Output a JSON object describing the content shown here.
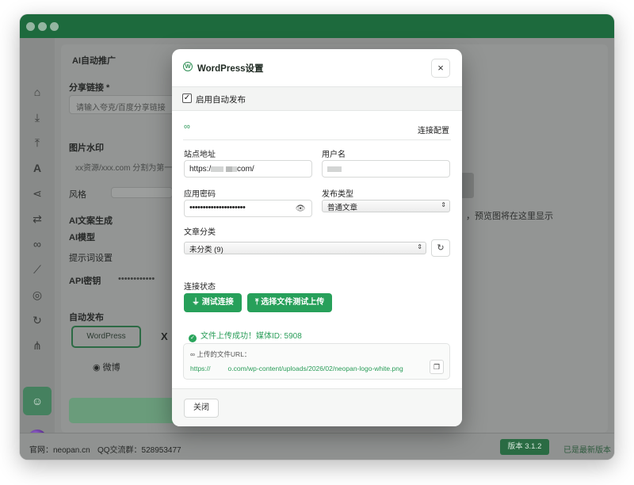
{
  "background": {
    "panel_title": "AI自动推广",
    "share_link_label": "分享链接 *",
    "share_link_placeholder": "请输入夸克/百度分享链接",
    "watermark_label": "图片水印",
    "watermark_placeholder": "xx资源/xxx.com  分割为第一",
    "style_label": "风格",
    "ai_copy_label": "AI文案生成",
    "ai_model_label": "AI模型",
    "prompt_label": "提示词设置",
    "api_key_label": "API密钥",
    "api_key_value": "••••••••••••",
    "auto_publish_label": "自动发布",
    "wordpress_btn": "WordPress",
    "x_btn": "X",
    "weibo_btn": "微博",
    "preview_hint": "，预览图将在这里显示",
    "footer_site": "官网：neopan.cn",
    "footer_qq": "QQ交流群：528953477",
    "version_badge": "版本 3.1.2",
    "latest_version": "已是最新版本"
  },
  "modal": {
    "title": "WordPress设置",
    "close_symbol": "×",
    "enable_auto_publish": "启用自动发布",
    "connection_config": "连接配置",
    "site_url_label": "站点地址",
    "site_url_prefix": "https:/",
    "site_url_suffix": "com/",
    "username_label": "用户名",
    "app_password_label": "应用密码",
    "app_password_value": "•••••••••••••••••••••",
    "post_type_label": "发布类型",
    "post_type_value": "普通文章",
    "category_label": "文章分类",
    "category_value": "未分类 (9)",
    "connection_status_label": "连接状态",
    "test_connection_btn": "测试连接",
    "upload_test_btn": "选择文件测试上传",
    "upload_success_msg": "文件上传成功！媒体ID: 5908",
    "uploaded_url_label": "上传的文件URL：",
    "uploaded_url_prefix": "https://",
    "uploaded_url_suffix": "o.com/wp-content/uploads/2026/02/neopan-logo-white.png",
    "footer_close_btn": "关闭"
  },
  "colors": {
    "accent_green": "#27a05a",
    "titlebar_green": "#1d6a3d",
    "overlay_grey": "#8e908f"
  }
}
